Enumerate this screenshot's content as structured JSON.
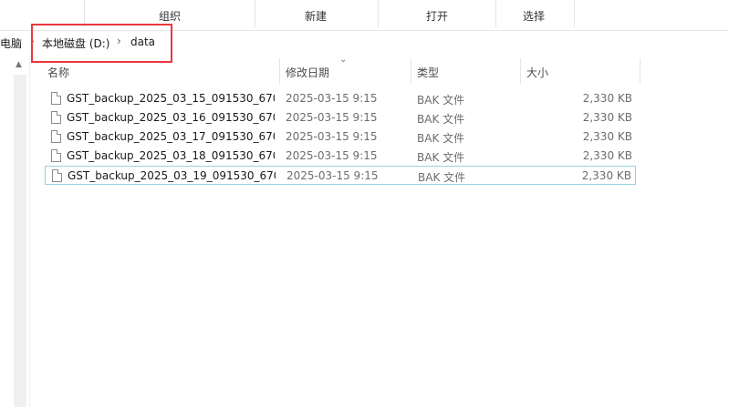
{
  "ribbon": {
    "groups": [
      "组织",
      "新建",
      "打开",
      "选择"
    ]
  },
  "address": {
    "root_partial": "电脑",
    "crumbs": [
      "本地磁盘 (D:)",
      "data"
    ]
  },
  "columns": {
    "name": "名称",
    "date": "修改日期",
    "type": "类型",
    "size": "大小"
  },
  "files": [
    {
      "name": "GST_backup_2025_03_15_091530_670...",
      "date": "2025-03-15 9:15",
      "type": "BAK 文件",
      "size": "2,330 KB"
    },
    {
      "name": "GST_backup_2025_03_16_091530_670...",
      "date": "2025-03-15 9:15",
      "type": "BAK 文件",
      "size": "2,330 KB"
    },
    {
      "name": "GST_backup_2025_03_17_091530_670...",
      "date": "2025-03-15 9:15",
      "type": "BAK 文件",
      "size": "2,330 KB"
    },
    {
      "name": "GST_backup_2025_03_18_091530_670...",
      "date": "2025-03-15 9:15",
      "type": "BAK 文件",
      "size": "2,330 KB"
    },
    {
      "name": "GST_backup_2025_03_19_091530_670...",
      "date": "2025-03-15 9:15",
      "type": "BAK 文件",
      "size": "2,330 KB"
    }
  ],
  "colors": {
    "highlight_box": "#e8383d",
    "selection_border": "#99d1e1"
  }
}
